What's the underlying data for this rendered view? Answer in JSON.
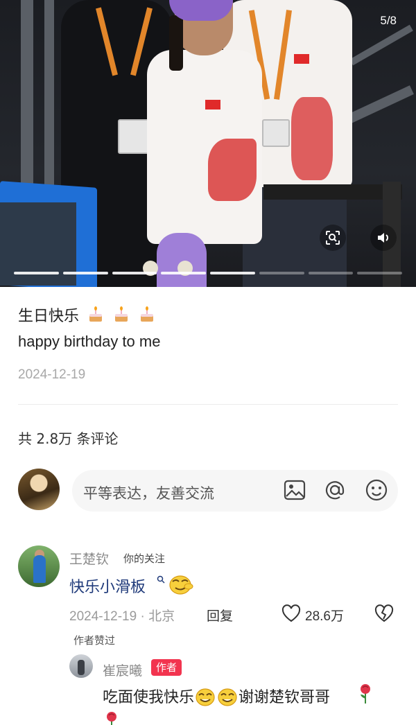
{
  "media": {
    "counter": "5/8",
    "total_slides": 8,
    "active_slide": 5,
    "scan_icon": "scan-image-icon",
    "volume_icon": "volume-icon"
  },
  "post": {
    "title": "生日快乐",
    "title_emojis": [
      "birthday-cake-emoji",
      "birthday-cake-emoji",
      "birthday-cake-emoji"
    ],
    "body": "happy birthday to me",
    "date": "2024-12-19"
  },
  "comments_header": {
    "count_text": "共 2.8万 条评论"
  },
  "comment_input": {
    "placeholder": "平等表达，友善交流",
    "icons": [
      "image-icon",
      "at-icon",
      "emoji-icon"
    ]
  },
  "comment": {
    "author": "王楚钦",
    "follow_tag": "你的关注",
    "text": "快乐小滑板",
    "meta": "2024-12-19 · 北京",
    "reply_label": "回复",
    "like_count": "28.6万",
    "author_liked": "作者赞过"
  },
  "reply": {
    "author": "崔宸曦",
    "badge": "作者",
    "text_before": "吃面使我快乐",
    "text_after": "谢谢楚钦哥哥"
  },
  "colors": {
    "link_text": "#1f3a7a",
    "badge_red": "#f2344f",
    "muted": "#9a9a9a"
  }
}
